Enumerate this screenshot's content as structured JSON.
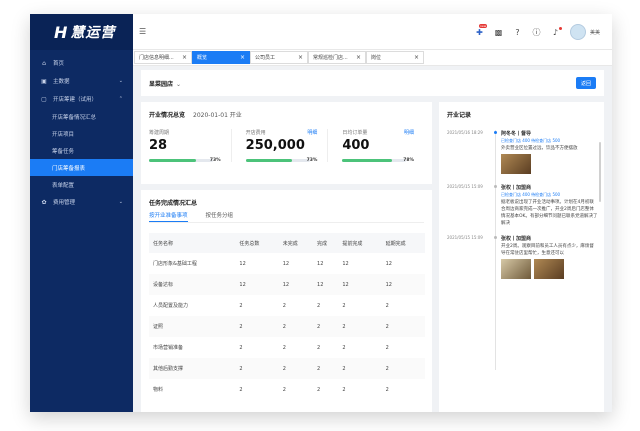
{
  "app": {
    "logo_mark": "H",
    "logo_text": "慧运营"
  },
  "sidebar": {
    "items": [
      {
        "label": "首页",
        "icon": "home-icon"
      },
      {
        "label": "主数据",
        "icon": "database-icon"
      },
      {
        "label": "开店筹建（试用）",
        "icon": "store-icon"
      }
    ],
    "sub_items": [
      "开店筹备情况汇总",
      "开店项目",
      "筹备任务",
      "门店筹备报表",
      "表单配置"
    ],
    "active_sub": "门店筹备报表",
    "bottom_item": {
      "label": "费用管理",
      "icon": "cost-icon"
    }
  },
  "topbar": {
    "user_name": "美美",
    "new_badge": "new"
  },
  "tabs": [
    {
      "label": "门店信息明细...",
      "active": false
    },
    {
      "label": "概览",
      "active": true
    },
    {
      "label": "公司员工",
      "active": false
    },
    {
      "label": "常规巡检门店...",
      "active": false
    },
    {
      "label": "岗位",
      "active": false
    }
  ],
  "store": {
    "name": "显菜园店",
    "back_label": "返回"
  },
  "summary": {
    "title": "开业情况总览",
    "date": "2020-01-01 开业",
    "metrics": [
      {
        "label": "筹建周期",
        "value": "28",
        "link": "",
        "progress_pct": 73,
        "progress_label": "73%"
      },
      {
        "label": "开店费用",
        "value": "250,000",
        "link": "明细",
        "progress_pct": 73,
        "progress_label": "73%"
      },
      {
        "label": "日均订单量",
        "value": "400",
        "link": "明细",
        "progress_pct": 78,
        "progress_label": "78%"
      }
    ]
  },
  "tasks": {
    "title": "任务完成情况汇总",
    "subtabs": [
      "按开业准备事项",
      "按任务分组"
    ],
    "columns": [
      "任务名称",
      "任务总数",
      "未完成",
      "完成",
      "提前完成",
      "延期完成"
    ],
    "rows": [
      [
        "门店形象&基础工程",
        "12",
        "12",
        "12",
        "12",
        "12"
      ],
      [
        "设备达标",
        "12",
        "12",
        "12",
        "12",
        "12"
      ],
      [
        "人员配置及能力",
        "2",
        "2",
        "2",
        "2",
        "2"
      ],
      [
        "证照",
        "2",
        "2",
        "2",
        "2",
        "2"
      ],
      [
        "市场营销准备",
        "2",
        "2",
        "2",
        "2",
        "2"
      ],
      [
        "其他后勤支撑",
        "2",
        "2",
        "2",
        "2",
        "2"
      ],
      [
        "物料",
        "2",
        "2",
        "2",
        "2",
        "2"
      ]
    ]
  },
  "timeline": {
    "title": "开业记录",
    "entries": [
      {
        "time": "2021/05/16 18:29",
        "name": "阿冬冬丨督导",
        "meta": "已检查门店 400  待检查门店 500",
        "text": "外卖营业区位置过远，饮品不方便摆放",
        "thumbs": 1
      },
      {
        "time": "2021/05/15 15:09",
        "name": "张权丨加盟商",
        "meta": "已检查门店 400  待检查门店 500",
        "text": "据老板说出现了开业活动事项。计划在4月初联合周边商家完成一次推广，开业2周后门店整体情况基本OK。有部分细节问题已联系党道解决了解决",
        "thumbs": 0
      },
      {
        "time": "2021/05/15 15:09",
        "name": "张权丨加盟商",
        "meta": "",
        "text": "开业2周。观察目前和员工人员有点少，麻烦督导在常驻店里帮忙，生意还可以",
        "thumbs": 2
      }
    ]
  }
}
